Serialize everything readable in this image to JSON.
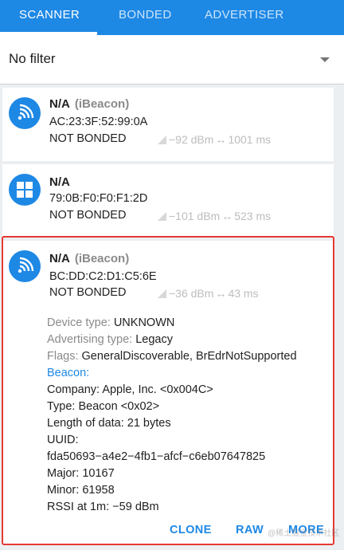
{
  "tabs": [
    {
      "label": "SCANNER",
      "active": true
    },
    {
      "label": "BONDED",
      "active": false
    },
    {
      "label": "ADVERTISER",
      "active": false
    }
  ],
  "filter": {
    "label": "No filter"
  },
  "devices": [
    {
      "name": "N/A",
      "display_name": "(iBeacon)",
      "address": "AC:23:3F:52:99:0A",
      "bond_state": "NOT BONDED",
      "rssi": "−92 dBm",
      "interval": "1001 ms",
      "icon": "bluetooth-signal-icon"
    },
    {
      "name": "N/A",
      "address": "79:0B:F0:F0:F1:2D",
      "bond_state": "NOT BONDED",
      "rssi": "−101 dBm",
      "interval": "523 ms",
      "icon": "windows-icon"
    },
    {
      "name": "N/A",
      "display_name": "(iBeacon)",
      "address": "BC:DD:C2:D1:C5:6E",
      "bond_state": "NOT BONDED",
      "rssi": "−36 dBm",
      "interval": "43 ms",
      "icon": "bluetooth-signal-icon",
      "details": {
        "device_type_label": "Device type:",
        "device_type": "UNKNOWN",
        "adv_type_label": "Advertising type:",
        "adv_type": "Legacy",
        "flags_label": "Flags:",
        "flags": "GeneralDiscoverable, BrEdrNotSupported",
        "beacon_label": "Beacon:",
        "company": "Company: Apple, Inc. <0x004C>",
        "type": "Type: Beacon <0x02>",
        "length": "Length of data: 21 bytes",
        "uuid_label": "UUID:",
        "uuid": "fda50693−a4e2−4fb1−afcf−c6eb07647825",
        "major": "Major: 10167",
        "minor": "Minor: 61958",
        "rssi_1m": "RSSI at 1m: −59 dBm"
      },
      "actions": [
        "CLONE",
        "RAW",
        "MORE"
      ]
    }
  ],
  "watermark": "@稀土掘金技术社区",
  "colors": {
    "accent": "#1e88e5",
    "highlight": "#e53935"
  }
}
